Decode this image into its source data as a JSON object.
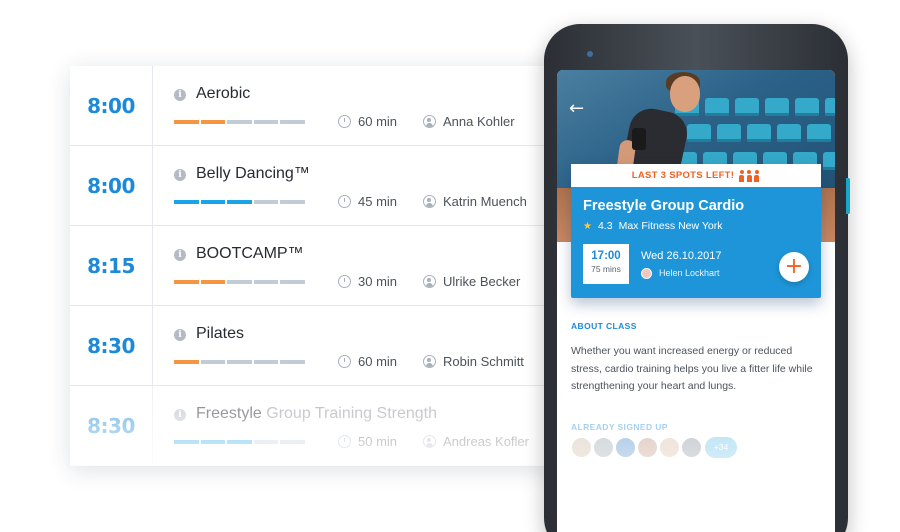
{
  "schedule": {
    "classes": [
      {
        "time": "8:00",
        "name": "Aerobic",
        "name_muted": "",
        "duration": "60 min",
        "trainer": "Anna Kohler"
      },
      {
        "time": "8:00",
        "name": "Belly Dancing™",
        "name_muted": "",
        "duration": "45 min",
        "trainer": "Katrin Muench"
      },
      {
        "time": "8:15",
        "name": "BOOTCAMP™",
        "name_muted": "",
        "duration": "30 min",
        "trainer": "Ulrike Becker"
      },
      {
        "time": "8:30",
        "name": "Pilates",
        "name_muted": "",
        "duration": "60 min",
        "trainer": "Robin Schmitt"
      },
      {
        "time": "8:30",
        "name": "Freestyle",
        "name_muted": " Group Training Strength",
        "duration": "50 min",
        "trainer": "Andreas Kofler"
      }
    ],
    "level_colors": {
      "orange": "#f59443",
      "blue": "#1aa3e6",
      "gray": "#c2ccd6"
    },
    "levels": [
      {
        "filled": 2,
        "of": 5,
        "color": "orange"
      },
      {
        "filled": 3,
        "of": 5,
        "color": "blue"
      },
      {
        "filled": 2,
        "of": 5,
        "color": "orange"
      },
      {
        "filled": 1,
        "of": 5,
        "color": "orange"
      },
      {
        "filled": 3,
        "of": 5,
        "color": "blue"
      }
    ]
  },
  "detail": {
    "banner": "LAST 3 SPOTS LEFT!",
    "title": "Freestyle Group Cardio",
    "rating": "4.3",
    "studio": "Max Fitness New York",
    "time": "17:00",
    "duration": "75 mins",
    "date": "Wed 26.10.2017",
    "host": "Helen Lockhart",
    "add_label": "+",
    "about_heading": "ABOUT CLASS",
    "about_text": "Whether you want increased energy or reduced stress, cardio training helps you live a fitter life while strengthening your heart and lungs.",
    "signed_heading": "ALREADY SIGNED UP",
    "more_count": "+34"
  },
  "icons": {
    "back": "back-arrow-icon",
    "star": "star-icon",
    "clock": "clock-icon",
    "trainer": "person-icon",
    "info": "info-icon"
  },
  "colors": {
    "accent": "#1d8ad9",
    "card": "#1e95d8",
    "alert": "#f26122"
  }
}
